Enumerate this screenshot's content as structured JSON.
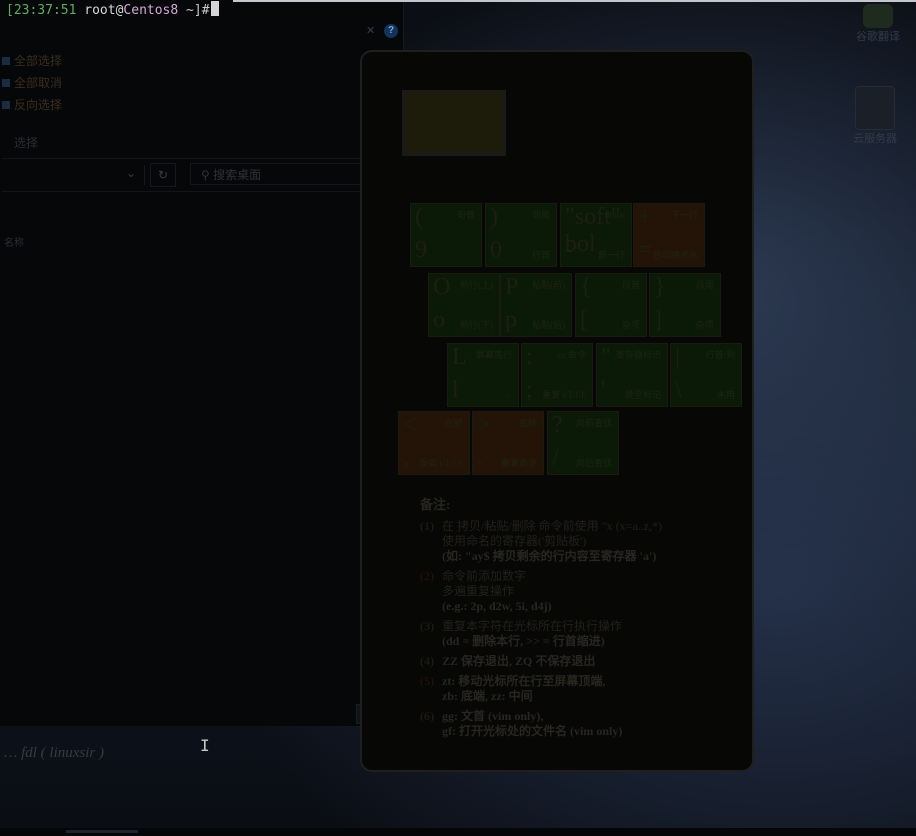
{
  "terminal": {
    "prompt_time": "[23:37:51",
    "prompt_user": "root",
    "prompt_at": "@",
    "prompt_host": "Centos8",
    "prompt_path": " ~]#"
  },
  "background_window": {
    "help_icon": "?",
    "options": [
      "全部选择",
      "全部取消",
      "反向选择"
    ],
    "section_label": "选择",
    "row_label": "名称",
    "search_placeholder": "搜索桌面",
    "bottom_icons": [
      "grid-icon",
      "arrow-icon"
    ]
  },
  "cheatsheet": {
    "keys": [
      {
        "id": "lparen",
        "top": "(",
        "top_note": "句首",
        "bot": "9",
        "bot_note": ""
      },
      {
        "id": "rparen",
        "top": ")",
        "top_note": "句尾",
        "bot": "0",
        "bot_note": "行首"
      },
      {
        "id": "soft",
        "top": "\"soft\" bol",
        "top_note": "down",
        "bot": "-",
        "bot_note": "前一行"
      },
      {
        "id": "plus",
        "top": "+",
        "top_note": "下一行",
        "bot": "=",
        "bot_note": "自动格式化"
      },
      {
        "id": "o",
        "top": "O",
        "top_note": "新行(上)",
        "bot": "o",
        "bot_note": "新行(下)"
      },
      {
        "id": "p",
        "top": "P",
        "top_note": "粘贴(前)",
        "bot": "p",
        "bot_note": "粘贴(后)"
      },
      {
        "id": "lbrace",
        "top": "{",
        "top_note": "段首",
        "bot": "[",
        "bot_note": "杂项"
      },
      {
        "id": "rbrace",
        "top": "}",
        "top_note": "段尾",
        "bot": "]",
        "bot_note": "杂项"
      },
      {
        "id": "L",
        "top": "L",
        "top_note": "屏幕底行",
        "bot": "l",
        "bot_note": "→"
      },
      {
        "id": "colon",
        "top": ":",
        "top_note": "ex 命令",
        "bot": ";",
        "bot_note": "重复 t/T/f/F"
      },
      {
        "id": "quote",
        "top": "\"",
        "top_note": "寄存器标识",
        "bot": "'",
        "bot_note": "跳至标记"
      },
      {
        "id": "pipe",
        "top": "|",
        "top_note": "行首/列",
        "bot": "\\",
        "bot_note": "未用"
      },
      {
        "id": "lt",
        "top": "<",
        "top_note": "左移",
        "bot": ",",
        "bot_note": "反向 t/T/f/F"
      },
      {
        "id": "gt",
        "top": ">",
        "top_note": "右移",
        "bot": ".",
        "bot_note": "重复命令"
      },
      {
        "id": "question",
        "top": "?",
        "top_note": "向前查找",
        "bot": "/",
        "bot_note": "向后查找"
      }
    ],
    "notes_title": "备注:",
    "notes": [
      {
        "num": "(1)",
        "red": false,
        "lines": [
          "在 拷贝/粘贴/删除 命令前使用 \"x (x=a..z,*)",
          "使用命名的寄存器('剪贴板')",
          "(如: \"ay$ 拷贝剩余的行内容至寄存器 'a')"
        ]
      },
      {
        "num": "(2)",
        "red": true,
        "lines": [
          "命令前添加数字",
          "多遍重复操作",
          "(e.g.: 2p, d2w, 5i, d4j)"
        ]
      },
      {
        "num": "(3)",
        "red": false,
        "lines": [
          "重复本字符在光标所在行执行操作",
          "(dd = 删除本行, >> = 行首缩进)"
        ]
      },
      {
        "num": "(4)",
        "red": false,
        "lines": [
          "ZZ 保存退出, ZQ 不保存退出"
        ]
      },
      {
        "num": "(5)",
        "red": true,
        "lines": [
          "zt: 移动光标所在行至屏幕顶端,",
          "zb: 底端, zz: 中间"
        ]
      },
      {
        "num": "(6)",
        "red": false,
        "lines": [
          "gg: 文首 (vim only),",
          "gf: 打开光标处的文件名 (vim only)"
        ]
      }
    ],
    "signature": "fdl ( linuxsir )"
  },
  "desktop_icons": [
    {
      "label": "谷歌翻译"
    },
    {
      "label": "云服务器"
    }
  ],
  "colors": {
    "terminal_bg": "#000000",
    "prompt_time": "#5fae5f",
    "prompt_host": "#d7a7d8"
  }
}
